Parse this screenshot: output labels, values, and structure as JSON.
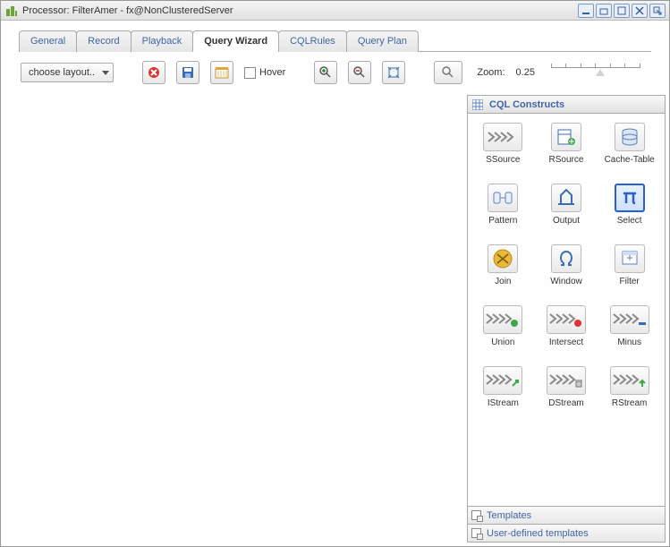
{
  "window": {
    "title": "Processor: FilterAmer - fx@NonClusteredServer"
  },
  "tabs": [
    "General",
    "Record",
    "Playback",
    "Query Wizard",
    "CQLRules",
    "Query Plan"
  ],
  "activeTab": 3,
  "toolbar": {
    "layoutSelect": "choose layout..",
    "hoverLabel": "Hover",
    "zoomLabel": "Zoom:",
    "zoomValue": "0.25"
  },
  "sidepanel": {
    "title": "CQL Constructs",
    "constructs": [
      {
        "label": "SSource",
        "icon": "chevrons"
      },
      {
        "label": "RSource",
        "icon": "rsource"
      },
      {
        "label": "Cache-Table",
        "icon": "db"
      },
      {
        "label": "Pattern",
        "icon": "pattern"
      },
      {
        "label": "Output",
        "icon": "output"
      },
      {
        "label": "Select",
        "icon": "pi",
        "selected": true
      },
      {
        "label": "Join",
        "icon": "join"
      },
      {
        "label": "Window",
        "icon": "omega"
      },
      {
        "label": "Filter",
        "icon": "filtericon"
      },
      {
        "label": "Union",
        "icon": "chevrons-green"
      },
      {
        "label": "Intersect",
        "icon": "chevrons-red"
      },
      {
        "label": "Minus",
        "icon": "chevrons-minus"
      },
      {
        "label": "IStream",
        "icon": "chevrons-arrow"
      },
      {
        "label": "DStream",
        "icon": "chevrons-trash"
      },
      {
        "label": "RStream",
        "icon": "chevrons-up"
      }
    ],
    "templatesLabel": "Templates",
    "userTemplatesLabel": "User-defined templates"
  }
}
